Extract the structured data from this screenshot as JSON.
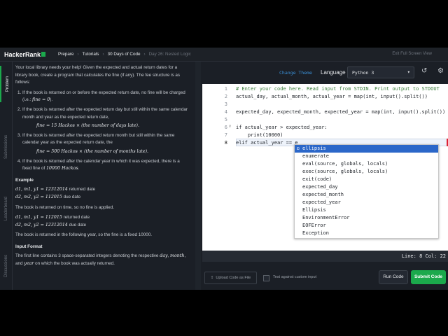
{
  "nav": {
    "logo": "HackerRank",
    "crumbs": [
      "Prepare",
      "Tutorials",
      "30 Days of Code",
      "Day 26: Nested Logic"
    ],
    "exit": "Exit Full Screen View"
  },
  "sidebar": {
    "tabs": [
      "Problem",
      "Submissions",
      "Leaderboard",
      "Discussions"
    ]
  },
  "problem": {
    "intro": "Your local library needs your help! Given the expected and actual return dates for a library book, create a program that calculates the fine (if any). The fee structure is as follows:",
    "rule1_a": "If the book is returned on or before the expected return date, no fine will be charged (i.e.: ",
    "rule1_math": "fine = 0",
    "rule1_b": ").",
    "rule2": "If the book is returned after the expected return day but still within the same calendar month and year as the expected return date,",
    "rule2_formula": "fine = 15 Hackos × (the number of days late).",
    "rule3": "If the book is returned after the expected return month but still within the same calendar year as the expected return date, the",
    "rule3_formula": "fine = 500 Hackos × (the number of months late).",
    "rule4_a": "If the book is returned after the calendar year in which it was expected, there is a fixed fine of ",
    "rule4_math": "10000 Hackos",
    "rule4_b": ".",
    "example_header": "Example",
    "ex1_line1_math": "d1, m1, y1 = 12312014",
    "ex1_line1_label": " returned date",
    "ex1_line2_math": "d2, m2, y2 = 112015",
    "ex1_line2_label": " due date",
    "ex1_result": "The book is returned on time, so no fine is applied.",
    "ex2_line1_math": "d1, m1, y1 = 112015",
    "ex2_line1_label": " returned date",
    "ex2_line2_math": "d2, m2, y2 = 12312014",
    "ex2_line2_label": " due date",
    "ex2_result": "The book is returned in the following year, so the fine is a fixed 10000.",
    "input_header": "Input Format",
    "input_text_a": "The first line contains 3 space-separated integers denoting the respective ",
    "input_math1": "day",
    "input_text_b": ", ",
    "input_math2": "month",
    "input_text_c": ", and ",
    "input_math3": "year",
    "input_text_d": " on which the book was actually returned."
  },
  "editor": {
    "change_theme": "Change Theme",
    "language_label": "Language",
    "language": "Python 3",
    "line_numbers": [
      "1",
      "2",
      "3",
      "4",
      "5",
      "6",
      "7",
      "8"
    ],
    "lines": [
      "# Enter your code here. Read input from STDIN. Print output to STDOUT",
      "actual_day, actual_month, actual_year = map(int, input().split())",
      "",
      "expected_day, expected_month, expected_year = map(int, input().split())",
      "",
      "if actual_year > expected_year:",
      "    print(10000)",
      "elif actual_year == e"
    ],
    "autocomplete": [
      "ellipsis",
      "enumerate",
      "eval(source, globals, locals)",
      "exec(source, globals, locals)",
      "exit(code)",
      "expected_day",
      "expected_month",
      "expected_year",
      "Ellipsis",
      "EnvironmentError",
      "EOFError",
      "Exception"
    ],
    "status": "Line: 8 Col: 22"
  },
  "actions": {
    "upload": "Upload Code as File",
    "custom_input": "Test against custom input",
    "run": "Run Code",
    "submit": "Submit Code"
  }
}
